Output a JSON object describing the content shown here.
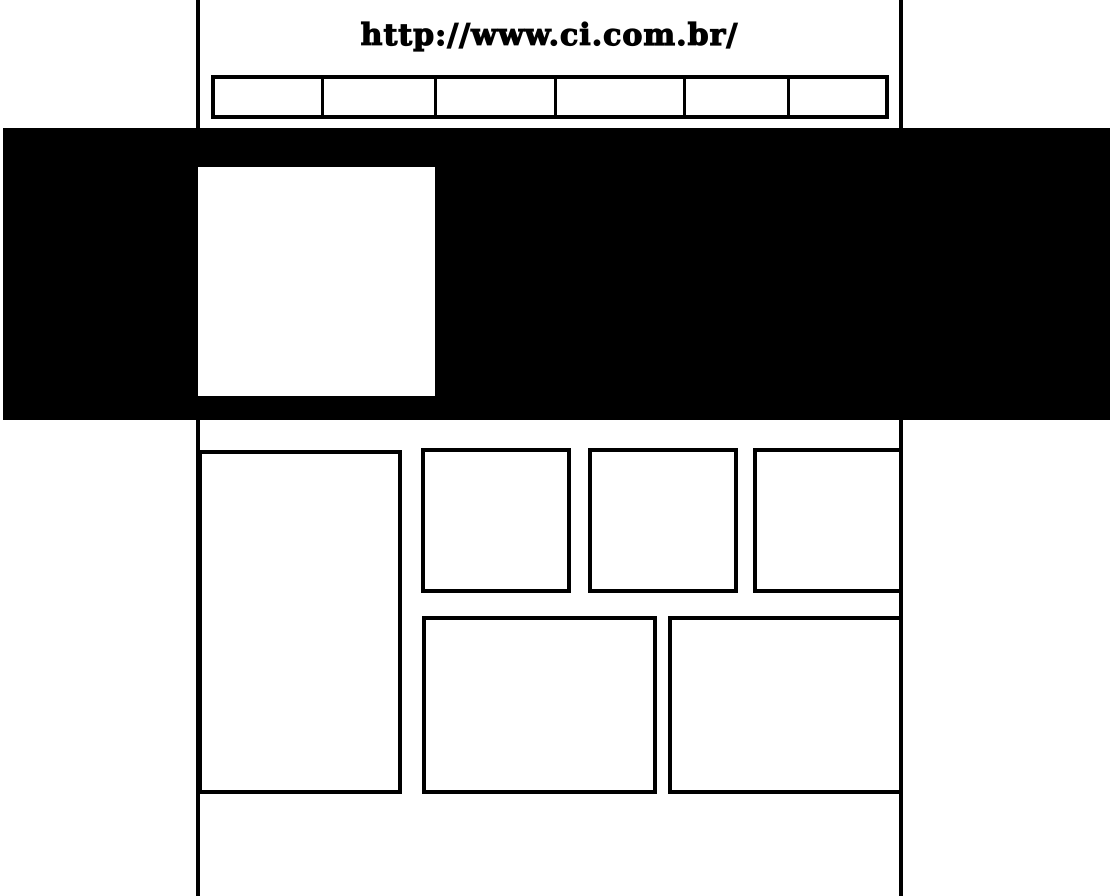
{
  "header": {
    "url": "http://www.ci.com.br/"
  },
  "nav": {
    "items": [
      "",
      "",
      "",
      "",
      "",
      ""
    ]
  },
  "colors": {
    "background": "#ffffff",
    "ink": "#000000"
  }
}
